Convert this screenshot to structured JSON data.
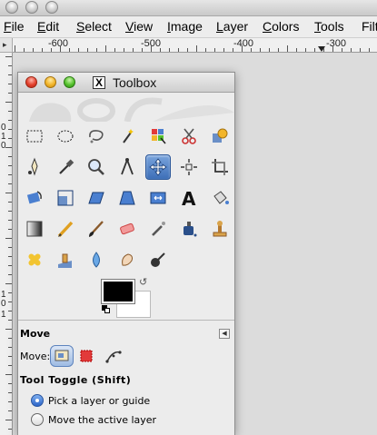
{
  "menubar": {
    "items": [
      {
        "underline": "F",
        "rest": "ile"
      },
      {
        "underline": "E",
        "rest": "dit"
      },
      {
        "underline": "S",
        "rest": "elect"
      },
      {
        "underline": "V",
        "rest": "iew"
      },
      {
        "underline": "I",
        "rest": "mage"
      },
      {
        "underline": "L",
        "rest": "ayer"
      },
      {
        "underline": "C",
        "rest": "olors"
      },
      {
        "underline": "T",
        "rest": "ools"
      },
      {
        "underline": "",
        "rest": "Filt"
      }
    ]
  },
  "ruler": {
    "labels": [
      "-600",
      "-500",
      "-400",
      "-300"
    ],
    "vertical_labels": [
      "0",
      "1",
      "0",
      "1",
      "0",
      "1"
    ]
  },
  "toolbox": {
    "window_title": "Toolbox",
    "tools": [
      {
        "name": "rect-select",
        "icon": "rect-select-icon"
      },
      {
        "name": "ellipse-select",
        "icon": "ellipse-select-icon"
      },
      {
        "name": "free-select",
        "icon": "lasso-icon"
      },
      {
        "name": "fuzzy-select",
        "icon": "magic-wand-icon"
      },
      {
        "name": "select-by-color",
        "icon": "color-select-icon"
      },
      {
        "name": "scissors-select",
        "icon": "scissors-icon"
      },
      {
        "name": "foreground-select",
        "icon": "foreground-select-icon"
      },
      {
        "name": "paths",
        "icon": "paths-icon"
      },
      {
        "name": "color-picker",
        "icon": "eyedropper-icon"
      },
      {
        "name": "zoom",
        "icon": "magnifier-icon"
      },
      {
        "name": "measure",
        "icon": "compass-icon"
      },
      {
        "name": "move",
        "icon": "move-icon",
        "active": true
      },
      {
        "name": "align",
        "icon": "align-icon"
      },
      {
        "name": "crop",
        "icon": "crop-icon"
      },
      {
        "name": "rotate",
        "icon": "rotate-icon"
      },
      {
        "name": "scale",
        "icon": "scale-icon"
      },
      {
        "name": "shear",
        "icon": "shear-icon"
      },
      {
        "name": "perspective",
        "icon": "perspective-icon"
      },
      {
        "name": "flip",
        "icon": "flip-icon"
      },
      {
        "name": "text",
        "icon": "text-icon"
      },
      {
        "name": "bucket-fill",
        "icon": "bucket-icon"
      },
      {
        "name": "blend",
        "icon": "gradient-icon"
      },
      {
        "name": "pencil",
        "icon": "pencil-icon"
      },
      {
        "name": "paintbrush",
        "icon": "paintbrush-icon"
      },
      {
        "name": "eraser",
        "icon": "eraser-icon"
      },
      {
        "name": "airbrush",
        "icon": "airbrush-icon"
      },
      {
        "name": "ink",
        "icon": "ink-icon"
      },
      {
        "name": "clone",
        "icon": "clone-stamp-icon"
      },
      {
        "name": "heal",
        "icon": "heal-icon"
      },
      {
        "name": "perspective-clone",
        "icon": "perspective-clone-icon"
      },
      {
        "name": "blur-sharpen",
        "icon": "blur-drop-icon"
      },
      {
        "name": "smudge",
        "icon": "smudge-icon"
      },
      {
        "name": "dodge-burn",
        "icon": "dodge-burn-icon"
      }
    ],
    "colors": {
      "foreground": "#000000",
      "background": "#ffffff"
    }
  },
  "tool_options": {
    "title": "Move",
    "move_label": "Move:",
    "toggle_title": "Tool Toggle  (Shift)",
    "options": [
      {
        "label": "Pick a layer or guide",
        "checked": true
      },
      {
        "label": "Move the active layer",
        "checked": false
      }
    ]
  },
  "colors": {
    "accent": "#3d6fb8",
    "menubar_bg": "#ededed"
  }
}
